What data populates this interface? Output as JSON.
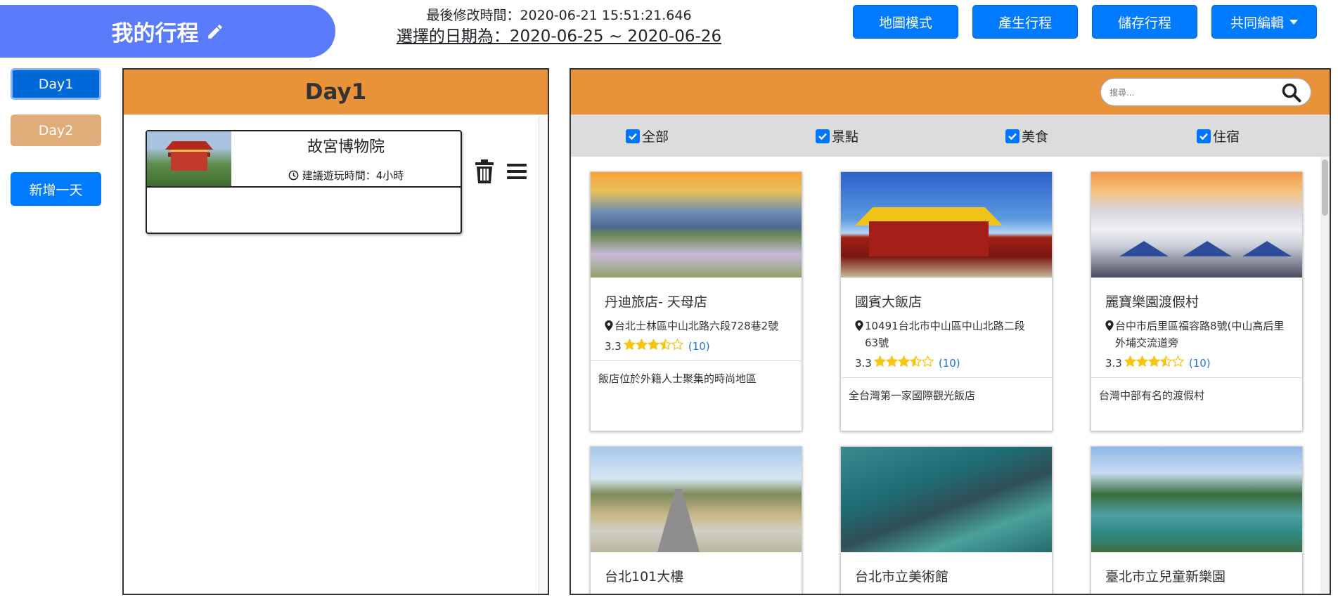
{
  "header": {
    "title": "我的行程",
    "last_modified": "最後修改時間：2020-06-21 15:51:21.646",
    "selected_range": "選擇的日期為：2020-06-25 ~ 2020-06-26",
    "buttons": {
      "map_mode": "地圖模式",
      "generate": "產生行程",
      "save": "儲存行程",
      "co_edit": "共同編輯"
    }
  },
  "days": {
    "day1": "Day1",
    "day2": "Day2",
    "add_day": "新增一天"
  },
  "day_panel": {
    "title": "Day1",
    "spot": {
      "name": "故宮博物院",
      "suggested": "建議遊玩時間：4小時"
    }
  },
  "browse": {
    "search_placeholder": "搜尋...",
    "filters": [
      "全部",
      "景點",
      "美食",
      "住宿"
    ],
    "cards": [
      {
        "name": "丹迪旅店- 天母店",
        "address": "台北士林區中山北路六段728巷2號",
        "rating": "3.3",
        "stars": 3.5,
        "count": "(10)",
        "desc": "飯店位於外籍人士聚集的時尚地區"
      },
      {
        "name": "國賓大飯店",
        "address": "10491台北市中山區中山北路二段63號",
        "rating": "3.3",
        "stars": 3.5,
        "count": "(10)",
        "desc": "全台灣第一家國際觀光飯店"
      },
      {
        "name": "麗寶樂園渡假村",
        "address": "台中市后里區福容路8號(中山高后里外埔交流道旁",
        "rating": "3.3",
        "stars": 3.5,
        "count": "(10)",
        "desc": "台灣中部有名的渡假村"
      },
      {
        "name": "台北101大樓"
      },
      {
        "name": "台北市立美術館"
      },
      {
        "name": "臺北市立兒童新樂園"
      }
    ]
  },
  "colors": {
    "accent_blue": "#007bff",
    "header_pill": "#5b7cfa",
    "panel_orange": "#e8923a",
    "day2_tan": "#e0ad7a",
    "star_gold": "#f5c518"
  }
}
